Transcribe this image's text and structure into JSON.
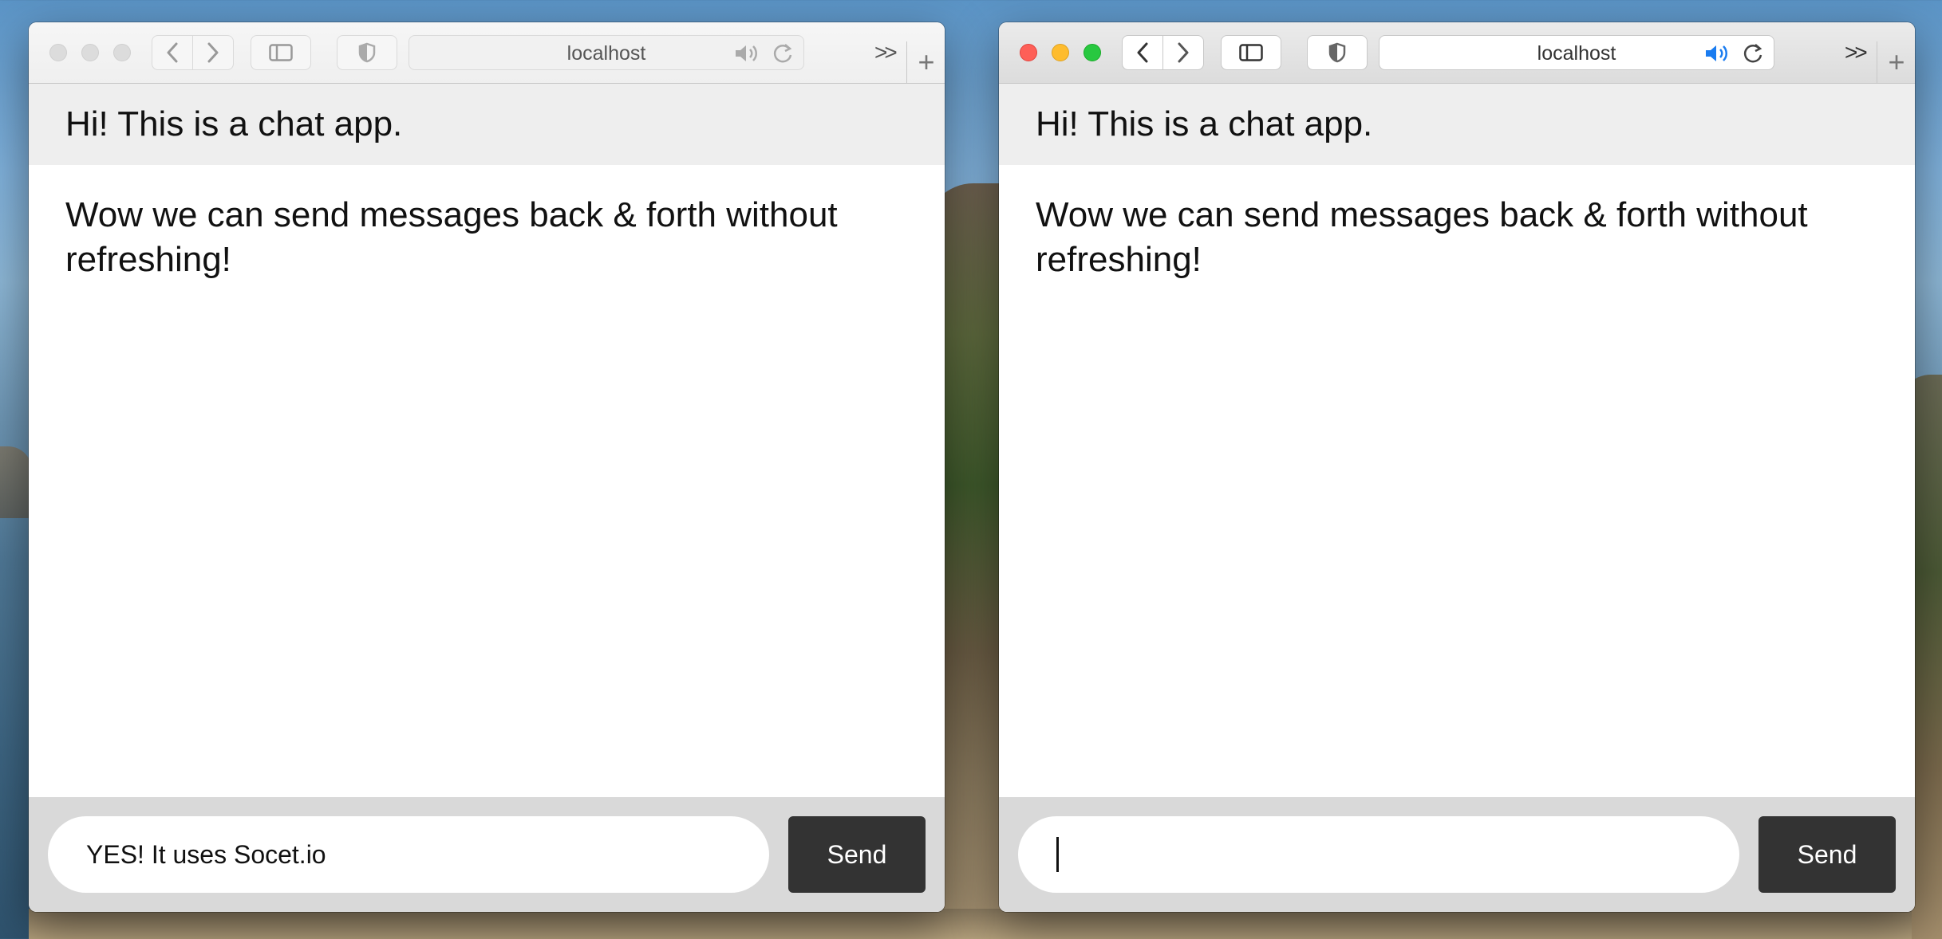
{
  "left_window": {
    "url": "localhost",
    "header_title": "Hi! This is a chat app.",
    "messages": [
      "Wow we can send messages back & forth without refreshing!"
    ],
    "input_value": "YES! It uses Socet.io",
    "send_label": "Send",
    "state": "inactive"
  },
  "right_window": {
    "url": "localhost",
    "header_title": "Hi! This is a chat app.",
    "messages": [
      "Wow we can send messages back & forth without refreshing!"
    ],
    "input_value": "",
    "send_label": "Send",
    "state": "active"
  },
  "toolbar": {
    "overflow_glyph": ">>",
    "new_tab_glyph": "+",
    "icons": [
      "back-icon",
      "forward-icon",
      "sidebar-icon",
      "shield-icon",
      "speaker-icon",
      "reload-icon"
    ]
  },
  "colors": {
    "send_button_bg": "#333333",
    "header_bg": "#eeeeee",
    "footer_bg": "#d9d9d9",
    "speaker_active": "#1a7cf0"
  }
}
